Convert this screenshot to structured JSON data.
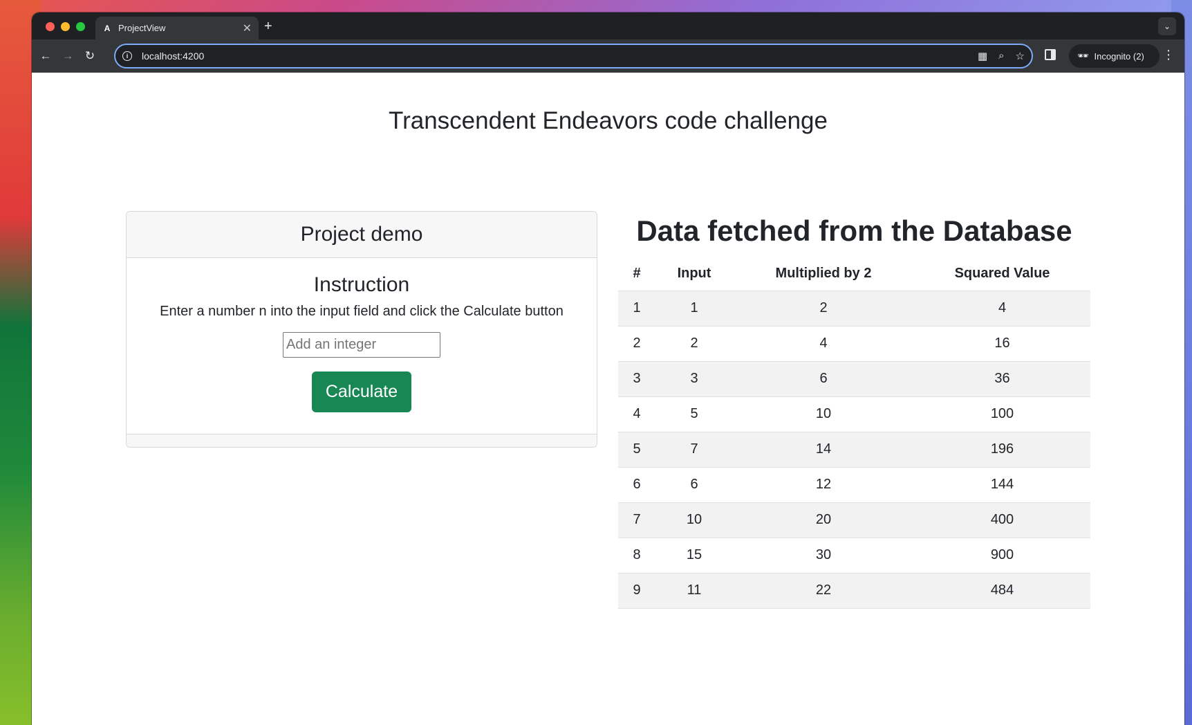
{
  "browser": {
    "tab_title": "ProjectView",
    "tab_favicon": "A",
    "close_glyph": "✕",
    "new_tab_glyph": "+",
    "tab_menu_glyph": "⌄",
    "url": "localhost:4200",
    "incognito_label": "Incognito (2)",
    "icons": [
      "back-arrow-icon",
      "forward-arrow-icon",
      "reload-icon",
      "site-info-icon",
      "qr-code-icon",
      "zoom-icon",
      "bookmark-star-icon",
      "side-panel-icon",
      "incognito-icon",
      "more-menu-icon"
    ]
  },
  "page": {
    "title": "Transcendent Endeavors code challenge"
  },
  "card": {
    "header": "Project demo",
    "instruction_heading": "Instruction",
    "instruction_text": "Enter a number n into the input field and click the Calculate button",
    "input_placeholder": "Add an integer",
    "button_label": "Calculate",
    "button_color": "#198754"
  },
  "database": {
    "title": "Data fetched from the Database",
    "columns": [
      "#",
      "Input",
      "Multiplied by 2",
      "Squared Value"
    ],
    "rows": [
      [
        "1",
        "1",
        "2",
        "4"
      ],
      [
        "2",
        "2",
        "4",
        "16"
      ],
      [
        "3",
        "3",
        "6",
        "36"
      ],
      [
        "4",
        "5",
        "10",
        "100"
      ],
      [
        "5",
        "7",
        "14",
        "196"
      ],
      [
        "6",
        "6",
        "12",
        "144"
      ],
      [
        "7",
        "10",
        "20",
        "400"
      ],
      [
        "8",
        "15",
        "30",
        "900"
      ],
      [
        "9",
        "11",
        "22",
        "484"
      ]
    ]
  }
}
